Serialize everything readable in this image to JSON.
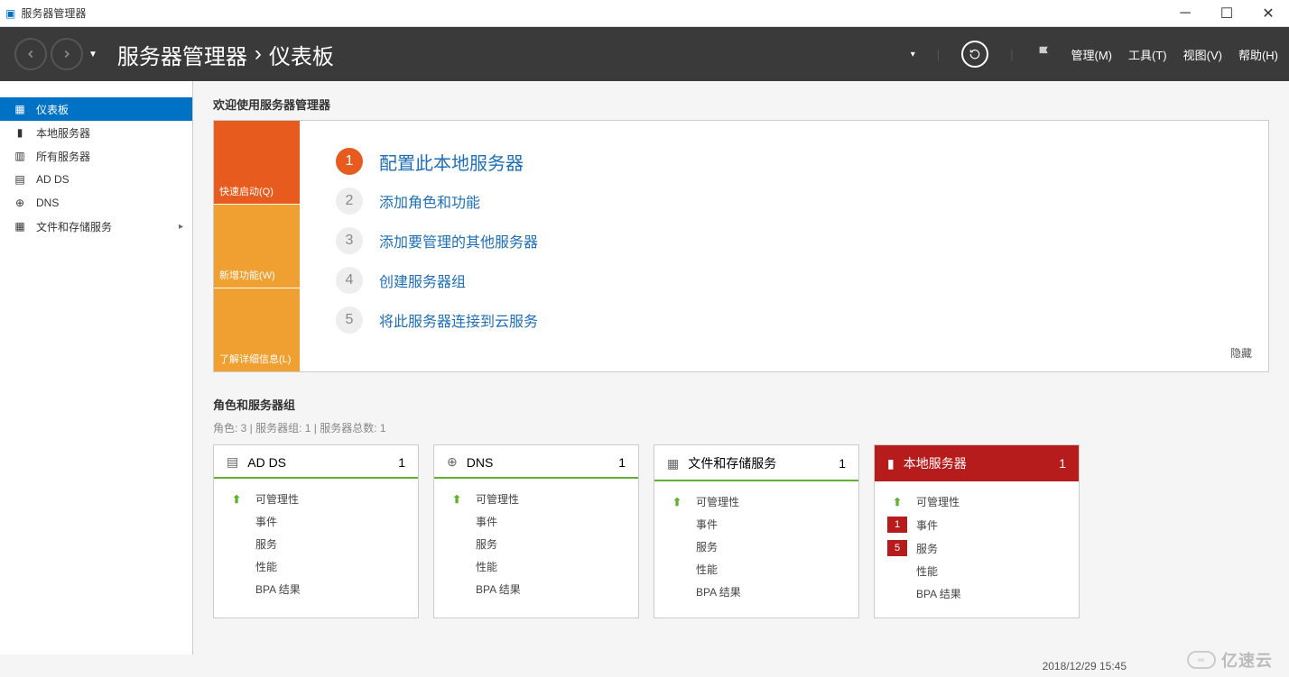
{
  "titlebar": {
    "title": "服务器管理器"
  },
  "header": {
    "breadcrumb_parent": "服务器管理器",
    "breadcrumb_current": "仪表板",
    "menu": {
      "manage": "管理(M)",
      "tools": "工具(T)",
      "view": "视图(V)",
      "help": "帮助(H)"
    }
  },
  "sidebar": {
    "items": [
      {
        "label": "仪表板",
        "icon": "dashboard",
        "active": true
      },
      {
        "label": "本地服务器",
        "icon": "local-server"
      },
      {
        "label": "所有服务器",
        "icon": "all-servers"
      },
      {
        "label": "AD DS",
        "icon": "adds"
      },
      {
        "label": "DNS",
        "icon": "dns"
      },
      {
        "label": "文件和存储服务",
        "icon": "file-storage",
        "expandable": true
      }
    ]
  },
  "welcome": {
    "title": "欢迎使用服务器管理器",
    "tabs": {
      "quick": "快速启动(Q)",
      "whatsnew": "新增功能(W)",
      "learn": "了解详细信息(L)"
    },
    "steps": [
      {
        "n": "1",
        "text": "配置此本地服务器",
        "primary": true
      },
      {
        "n": "2",
        "text": "添加角色和功能"
      },
      {
        "n": "3",
        "text": "添加要管理的其他服务器"
      },
      {
        "n": "4",
        "text": "创建服务器组"
      },
      {
        "n": "5",
        "text": "将此服务器连接到云服务"
      }
    ],
    "hide": "隐藏"
  },
  "roles": {
    "title": "角色和服务器组",
    "subtitle": "角色: 3 | 服务器组: 1 | 服务器总数: 1",
    "row_labels": {
      "manage": "可管理性",
      "events": "事件",
      "services": "服务",
      "perf": "性能",
      "bpa": "BPA 结果"
    },
    "tiles": [
      {
        "title": "AD DS",
        "count": "1",
        "alert": false,
        "icon": "adds",
        "rows": []
      },
      {
        "title": "DNS",
        "count": "1",
        "alert": false,
        "icon": "dns",
        "rows": []
      },
      {
        "title": "文件和存储服务",
        "count": "1",
        "alert": false,
        "icon": "file-storage",
        "rows": []
      },
      {
        "title": "本地服务器",
        "count": "1",
        "alert": true,
        "icon": "local-server",
        "events_badge": "1",
        "services_badge": "5"
      }
    ]
  },
  "statusbar": {
    "datetime": "2018/12/29 15:45"
  },
  "watermark": "亿速云"
}
